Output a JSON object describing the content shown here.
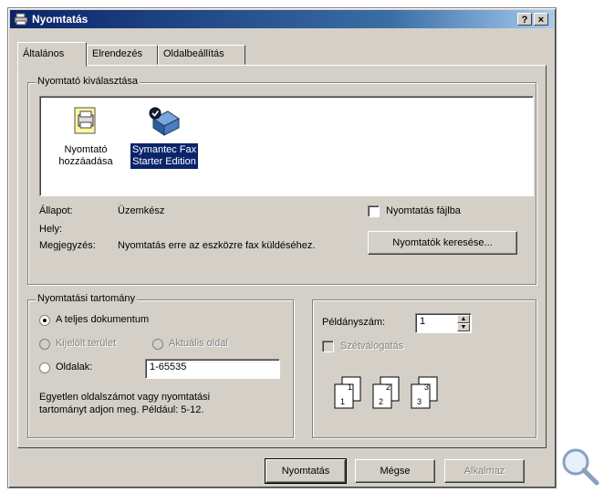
{
  "window": {
    "title": "Nyomtatás",
    "help_btn": "?",
    "close_btn": "×"
  },
  "tabs": [
    {
      "label": "Általános",
      "active": true
    },
    {
      "label": "Elrendezés",
      "active": false
    },
    {
      "label": "Oldalbeállítás",
      "active": false
    }
  ],
  "printer_select": {
    "legend": "Nyomtató kiválasztása",
    "items": [
      {
        "line1": "Nyomtató",
        "line2": "hozzáadása",
        "icon": "add-printer-icon",
        "selected": false
      },
      {
        "line1": "Symantec Fax",
        "line2": "Starter Edition",
        "icon": "fax-printer-icon",
        "selected": true
      }
    ],
    "status_label": "Állapot:",
    "status_value": "Üzemkész",
    "location_label": "Hely:",
    "comment_label": "Megjegyzés:",
    "comment_value": "Nyomtatás erre az eszközre fax küldéséhez.",
    "print_to_file_label": "Nyomtatás fájlba",
    "print_to_file_checked": false,
    "find_printers_label": "Nyomtatók keresése..."
  },
  "range": {
    "legend": "Nyomtatási tartomány",
    "all_label": "A teljes dokumentum",
    "selection_label": "Kijelölt terület",
    "current_page_label": "Aktuális oldal",
    "pages_label": "Oldalak:",
    "pages_value": "1-65535",
    "hint_line1": "Egyetlen oldalszámot vagy nyomtatási",
    "hint_line2": "tartományt adjon meg. Például: 5-12.",
    "selected": "all"
  },
  "copies": {
    "label": "Példányszám:",
    "value": "1",
    "collate_label": "Szétválogatás",
    "collate_checked": false,
    "collate_pages": [
      "1",
      "1",
      "2",
      "2",
      "3",
      "3"
    ]
  },
  "buttons": {
    "print": "Nyomtatás",
    "cancel": "Mégse",
    "apply": "Alkalmaz"
  },
  "colors": {
    "face": "#d4d0c8",
    "title_start": "#0a246a",
    "title_end": "#a6caf0",
    "selection": "#0a246a"
  },
  "extra_icons": {
    "corner": "magnifier-icon"
  }
}
